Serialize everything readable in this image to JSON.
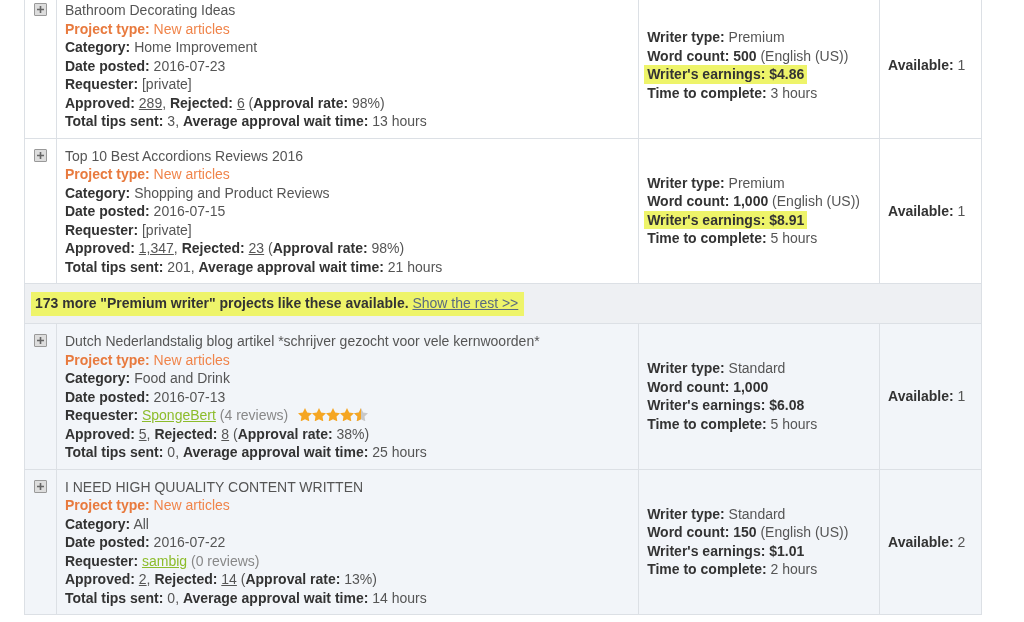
{
  "projects": [
    {
      "title": "Bathroom Decorating Ideas",
      "expanded": false,
      "shaded": false,
      "details": [
        {
          "segments": [
            {
              "kind": "type_label",
              "text": "Project type:"
            },
            {
              "kind": "type_value",
              "text": " New articles"
            }
          ]
        },
        {
          "segments": [
            {
              "kind": "label",
              "text": "Category:"
            },
            {
              "kind": "value",
              "text": " Home Improvement"
            }
          ]
        },
        {
          "segments": [
            {
              "kind": "label",
              "text": "Date posted:"
            },
            {
              "kind": "value",
              "text": " 2016-07-23"
            }
          ]
        },
        {
          "segments": [
            {
              "kind": "label",
              "text": "Requester:"
            },
            {
              "kind": "value",
              "text": " [private]"
            }
          ]
        },
        {
          "segments": [
            {
              "kind": "label",
              "text": "Approved: "
            },
            {
              "kind": "count",
              "text": "289"
            },
            {
              "kind": "value",
              "text": ", "
            },
            {
              "kind": "label",
              "text": "Rejected: "
            },
            {
              "kind": "count",
              "text": "6"
            },
            {
              "kind": "value",
              "text": " ("
            },
            {
              "kind": "label",
              "text": "Approval rate:"
            },
            {
              "kind": "value",
              "text": " 98%)"
            }
          ]
        },
        {
          "segments": [
            {
              "kind": "label",
              "text": "Total tips sent:"
            },
            {
              "kind": "value",
              "text": " 3, "
            },
            {
              "kind": "label",
              "text": "Average approval wait time:"
            },
            {
              "kind": "value",
              "text": " 13 hours"
            }
          ]
        }
      ],
      "writer": [
        {
          "highlighted": false,
          "segments": [
            {
              "kind": "label",
              "text": "Writer type:"
            },
            {
              "kind": "value",
              "text": " Premium"
            }
          ]
        },
        {
          "highlighted": false,
          "segments": [
            {
              "kind": "label",
              "text": "Word count: 500"
            },
            {
              "kind": "value",
              "text": " (English (US))"
            }
          ]
        },
        {
          "highlighted": true,
          "segments": [
            {
              "kind": "label",
              "text": "Writer's earnings: $4.86"
            }
          ]
        },
        {
          "highlighted": false,
          "segments": [
            {
              "kind": "label",
              "text": "Time to complete:"
            },
            {
              "kind": "value",
              "text": " 3 hours"
            }
          ]
        }
      ],
      "available": [
        {
          "kind": "label",
          "text": "Available:"
        },
        {
          "kind": "value",
          "text": " 1"
        }
      ]
    },
    {
      "title": "Top 10 Best Accordions Reviews 2016",
      "expanded": false,
      "shaded": false,
      "details": [
        {
          "segments": [
            {
              "kind": "type_label",
              "text": "Project type:"
            },
            {
              "kind": "type_value",
              "text": " New articles"
            }
          ]
        },
        {
          "segments": [
            {
              "kind": "label",
              "text": "Category:"
            },
            {
              "kind": "value",
              "text": " Shopping and Product Reviews"
            }
          ]
        },
        {
          "segments": [
            {
              "kind": "label",
              "text": "Date posted:"
            },
            {
              "kind": "value",
              "text": " 2016-07-15"
            }
          ]
        },
        {
          "segments": [
            {
              "kind": "label",
              "text": "Requester:"
            },
            {
              "kind": "value",
              "text": " [private]"
            }
          ]
        },
        {
          "segments": [
            {
              "kind": "label",
              "text": "Approved: "
            },
            {
              "kind": "count",
              "text": "1,347"
            },
            {
              "kind": "value",
              "text": ", "
            },
            {
              "kind": "label",
              "text": "Rejected: "
            },
            {
              "kind": "count",
              "text": "23"
            },
            {
              "kind": "value",
              "text": " ("
            },
            {
              "kind": "label",
              "text": "Approval rate:"
            },
            {
              "kind": "value",
              "text": " 98%)"
            }
          ]
        },
        {
          "segments": [
            {
              "kind": "label",
              "text": "Total tips sent:"
            },
            {
              "kind": "value",
              "text": " 201, "
            },
            {
              "kind": "label",
              "text": "Average approval wait time:"
            },
            {
              "kind": "value",
              "text": " 21 hours"
            }
          ]
        }
      ],
      "writer": [
        {
          "highlighted": false,
          "segments": [
            {
              "kind": "label",
              "text": "Writer type:"
            },
            {
              "kind": "value",
              "text": " Premium"
            }
          ]
        },
        {
          "highlighted": false,
          "segments": [
            {
              "kind": "label",
              "text": "Word count: 1,000"
            },
            {
              "kind": "value",
              "text": " (English (US))"
            }
          ]
        },
        {
          "highlighted": true,
          "segments": [
            {
              "kind": "label",
              "text": "Writer's earnings: $8.91"
            }
          ]
        },
        {
          "highlighted": false,
          "segments": [
            {
              "kind": "label",
              "text": "Time to complete:"
            },
            {
              "kind": "value",
              "text": " 5 hours"
            }
          ]
        }
      ],
      "available": [
        {
          "kind": "label",
          "text": "Available:"
        },
        {
          "kind": "value",
          "text": " 1"
        }
      ]
    },
    {
      "kind": "banner",
      "text": "173 more \"Premium writer\" projects like these available.",
      "link": "Show the rest >>"
    },
    {
      "title": "Dutch Nederlandstalig blog artikel *schrijver gezocht voor vele kernwoorden*",
      "expanded": false,
      "shaded": true,
      "details": [
        {
          "segments": [
            {
              "kind": "type_label",
              "text": "Project type:"
            },
            {
              "kind": "type_value",
              "text": " New articles"
            }
          ]
        },
        {
          "segments": [
            {
              "kind": "label",
              "text": "Category:"
            },
            {
              "kind": "value",
              "text": " Food and Drink"
            }
          ]
        },
        {
          "segments": [
            {
              "kind": "label",
              "text": "Date posted:"
            },
            {
              "kind": "value",
              "text": " 2016-07-13"
            }
          ]
        },
        {
          "stars": 4.5,
          "segments": [
            {
              "kind": "label",
              "text": "Requester: "
            },
            {
              "kind": "user",
              "text": "SpongeBert"
            },
            {
              "kind": "note",
              "text": " (4 reviews)"
            }
          ]
        },
        {
          "segments": [
            {
              "kind": "label",
              "text": "Approved: "
            },
            {
              "kind": "count",
              "text": "5"
            },
            {
              "kind": "value",
              "text": ", "
            },
            {
              "kind": "label",
              "text": "Rejected: "
            },
            {
              "kind": "count",
              "text": "8"
            },
            {
              "kind": "value",
              "text": " ("
            },
            {
              "kind": "label",
              "text": "Approval rate:"
            },
            {
              "kind": "value",
              "text": " 38%)"
            }
          ]
        },
        {
          "segments": [
            {
              "kind": "label",
              "text": "Total tips sent:"
            },
            {
              "kind": "value",
              "text": " 0, "
            },
            {
              "kind": "label",
              "text": "Average approval wait time:"
            },
            {
              "kind": "value",
              "text": " 25 hours"
            }
          ]
        }
      ],
      "writer": [
        {
          "highlighted": false,
          "segments": [
            {
              "kind": "label",
              "text": "Writer type:"
            },
            {
              "kind": "value",
              "text": " Standard"
            }
          ]
        },
        {
          "highlighted": false,
          "segments": [
            {
              "kind": "label",
              "text": "Word count: 1,000"
            }
          ]
        },
        {
          "highlighted": false,
          "segments": [
            {
              "kind": "label",
              "text": "Writer's earnings: $6.08"
            }
          ]
        },
        {
          "highlighted": false,
          "segments": [
            {
              "kind": "label",
              "text": "Time to complete:"
            },
            {
              "kind": "value",
              "text": " 5 hours"
            }
          ]
        }
      ],
      "available": [
        {
          "kind": "label",
          "text": "Available:"
        },
        {
          "kind": "value",
          "text": " 1"
        }
      ]
    },
    {
      "title": "I NEED HIGH QUUALITY CONTENT WRITTEN",
      "expanded": false,
      "shaded": true,
      "details": [
        {
          "segments": [
            {
              "kind": "type_label",
              "text": "Project type:"
            },
            {
              "kind": "type_value",
              "text": " New articles"
            }
          ]
        },
        {
          "segments": [
            {
              "kind": "label",
              "text": "Category:"
            },
            {
              "kind": "value",
              "text": " All"
            }
          ]
        },
        {
          "segments": [
            {
              "kind": "label",
              "text": "Date posted:"
            },
            {
              "kind": "value",
              "text": " 2016-07-22"
            }
          ]
        },
        {
          "segments": [
            {
              "kind": "label",
              "text": "Requester: "
            },
            {
              "kind": "user",
              "text": "sambig"
            },
            {
              "kind": "note",
              "text": " (0 reviews)"
            }
          ]
        },
        {
          "segments": [
            {
              "kind": "label",
              "text": "Approved: "
            },
            {
              "kind": "count",
              "text": "2"
            },
            {
              "kind": "value",
              "text": ", "
            },
            {
              "kind": "label",
              "text": "Rejected: "
            },
            {
              "kind": "count",
              "text": "14"
            },
            {
              "kind": "value",
              "text": " ("
            },
            {
              "kind": "label",
              "text": "Approval rate:"
            },
            {
              "kind": "value",
              "text": " 13%)"
            }
          ]
        },
        {
          "segments": [
            {
              "kind": "label",
              "text": "Total tips sent:"
            },
            {
              "kind": "value",
              "text": " 0, "
            },
            {
              "kind": "label",
              "text": "Average approval wait time:"
            },
            {
              "kind": "value",
              "text": " 14 hours"
            }
          ]
        }
      ],
      "writer": [
        {
          "highlighted": false,
          "segments": [
            {
              "kind": "label",
              "text": "Writer type:"
            },
            {
              "kind": "value",
              "text": " Standard"
            }
          ]
        },
        {
          "highlighted": false,
          "segments": [
            {
              "kind": "label",
              "text": "Word count: 150"
            },
            {
              "kind": "value",
              "text": " (English (US))"
            }
          ]
        },
        {
          "highlighted": false,
          "segments": [
            {
              "kind": "label",
              "text": "Writer's earnings: $1.01"
            }
          ]
        },
        {
          "highlighted": false,
          "segments": [
            {
              "kind": "label",
              "text": "Time to complete:"
            },
            {
              "kind": "value",
              "text": " 2 hours"
            }
          ]
        }
      ],
      "available": [
        {
          "kind": "label",
          "text": "Available:"
        },
        {
          "kind": "value",
          "text": " 2"
        }
      ]
    }
  ]
}
